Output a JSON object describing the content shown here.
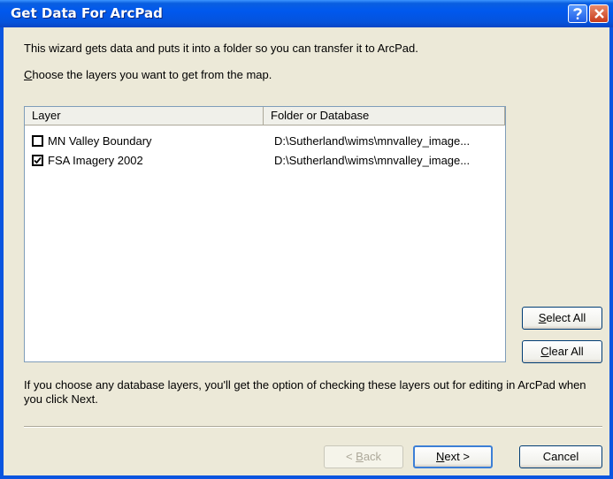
{
  "window": {
    "title": "Get Data For ArcPad"
  },
  "intro_text": "This wizard gets data and puts it into a folder so you can transfer it to ArcPad.",
  "choose": {
    "mnemonic": "C",
    "rest": "hoose the layers you want to get from the map."
  },
  "list": {
    "columns": [
      "Layer",
      "Folder or Database"
    ],
    "rows": [
      {
        "name": "MN Valley Boundary",
        "path": "D:\\Sutherland\\wims\\mnvalley_image...",
        "checked": false
      },
      {
        "name": "FSA Imagery 2002",
        "path": "D:\\Sutherland\\wims\\mnvalley_image...",
        "checked": true
      }
    ]
  },
  "buttons": {
    "select_all": {
      "mnemonic": "S",
      "rest": "elect All"
    },
    "clear_all": {
      "mnemonic": "C",
      "rest": "lear All"
    },
    "back": {
      "prefix": "< ",
      "mnemonic": "B",
      "rest": "ack"
    },
    "next": {
      "mnemonic": "N",
      "rest": "ext >"
    },
    "cancel": "Cancel"
  },
  "note": "If you choose any database layers, you'll get the option of checking these layers out for editing in ArcPad when you click Next.",
  "icons": {
    "help": "help-icon",
    "close": "close-icon",
    "checkbox": "checkmark-icon"
  }
}
